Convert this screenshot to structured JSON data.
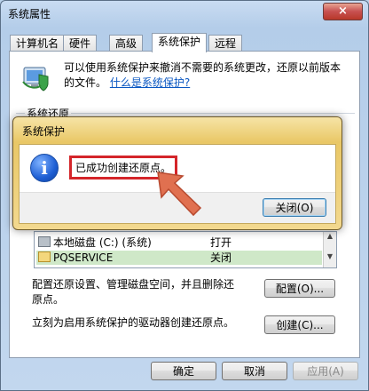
{
  "window": {
    "title": "系统属性",
    "close_glyph": "×"
  },
  "tabs": [
    "计算机名",
    "硬件",
    "高级",
    "系统保护",
    "远程"
  ],
  "active_tab": 3,
  "intro": {
    "text": "可以使用系统保护来撤消不需要的系统更改，还原以前版本的文件。",
    "link": "什么是系统保护?"
  },
  "restore_group": {
    "label": "系统还原"
  },
  "drives": [
    {
      "name": "本地磁盘 (C:) (系统)",
      "state": "打开",
      "icon": "drive-icon"
    },
    {
      "name": "PQSERVICE",
      "state": "关闭",
      "icon": "folder-icon"
    }
  ],
  "configure": {
    "text": "配置还原设置、管理磁盘空间，并且删除还原点。",
    "button": "配置(O)..."
  },
  "create": {
    "text": "立刻为启用系统保护的驱动器创建还原点。",
    "button": "创建(C)..."
  },
  "footer": {
    "ok": "确定",
    "cancel": "取消",
    "apply": "应用(A)"
  },
  "dialog": {
    "title": "系统保护",
    "message": "已成功创建还原点。",
    "close_button": "关闭(O)"
  },
  "colors": {
    "highlight_box": "#d4252a",
    "arrow": "#e07050",
    "dialog_frame": "#e9c766"
  }
}
